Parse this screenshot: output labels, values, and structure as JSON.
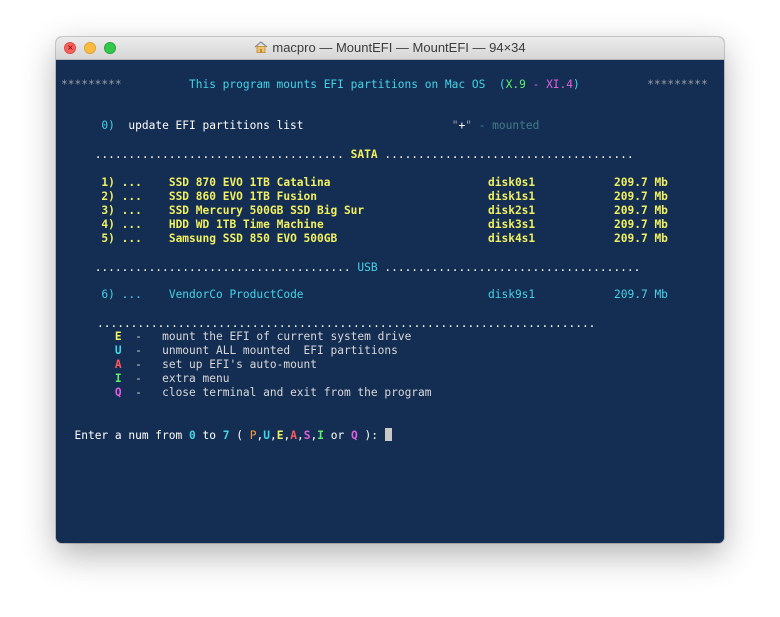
{
  "window": {
    "title": "macpro — MountEFI — MountEFI — 94×34"
  },
  "header": {
    "stars_left": "*********",
    "text": "This program mounts EFI partitions on Mac OS",
    "paren_open": "(",
    "ver_from": "X.9",
    "dash": "-",
    "ver_to": "XI.4",
    "paren_close": ")",
    "stars_right": "*********"
  },
  "update": {
    "num": "0)",
    "label": "update EFI partitions list",
    "legend_q1": "\"",
    "legend_plus": "+",
    "legend_q2": "\"",
    "legend_text": " - mounted"
  },
  "sata": {
    "sep_left": ".....................................",
    "title": "SATA",
    "sep_right": ".....................................",
    "items": [
      {
        "num": "1)",
        "dots": "...",
        "name": "SSD 870 EVO 1TB Catalina",
        "disk": "disk0s1",
        "size": "209.7",
        "unit": "Mb"
      },
      {
        "num": "2)",
        "dots": "...",
        "name": "SSD 860 EVO 1TB Fusion",
        "disk": "disk1s1",
        "size": "209.7",
        "unit": "Mb"
      },
      {
        "num": "3)",
        "dots": "...",
        "name": "SSD Mercury 500GB SSD Big Sur",
        "disk": "disk2s1",
        "size": "209.7",
        "unit": "Mb"
      },
      {
        "num": "4)",
        "dots": "...",
        "name": "HDD WD 1TB Time Machine",
        "disk": "disk3s1",
        "size": "209.7",
        "unit": "Mb"
      },
      {
        "num": "5)",
        "dots": "...",
        "name": "Samsung SSD 850 EVO 500GB",
        "disk": "disk4s1",
        "size": "209.7",
        "unit": "Mb"
      }
    ]
  },
  "usb": {
    "sep_left": "......................................",
    "title": "USB",
    "sep_right": "......................................",
    "items": [
      {
        "num": "6)",
        "dots": "...",
        "name": "VendorCo ProductCode",
        "disk": "disk9s1",
        "size": "209.7",
        "unit": "Mb"
      }
    ]
  },
  "separator_full": "..........................................................................",
  "commands": [
    {
      "key": "E",
      "dash": "-",
      "text": "mount the EFI of current system drive",
      "color": "#f0f060"
    },
    {
      "key": "U",
      "dash": "-",
      "text": "unmount ALL mounted  EFI partitions",
      "color": "#44d4e8"
    },
    {
      "key": "A",
      "dash": "-",
      "text": "set up EFI's auto-mount",
      "color": "#ff5a5a"
    },
    {
      "key": "I",
      "dash": "-",
      "text": "extra menu",
      "color": "#5ff06a"
    },
    {
      "key": "Q",
      "dash": "-",
      "text": "close terminal and exit from the program",
      "color": "#e060e0"
    }
  ],
  "prompt": {
    "lead": "Enter a num from",
    "from": "0",
    "to_word": "to",
    "to": "7",
    "paren_open": "(",
    "keys": [
      "P",
      "U",
      "E",
      "A",
      "S",
      "I"
    ],
    "comma": ",",
    "or_word": "or",
    "last_key": "Q",
    "paren_close": "):"
  }
}
